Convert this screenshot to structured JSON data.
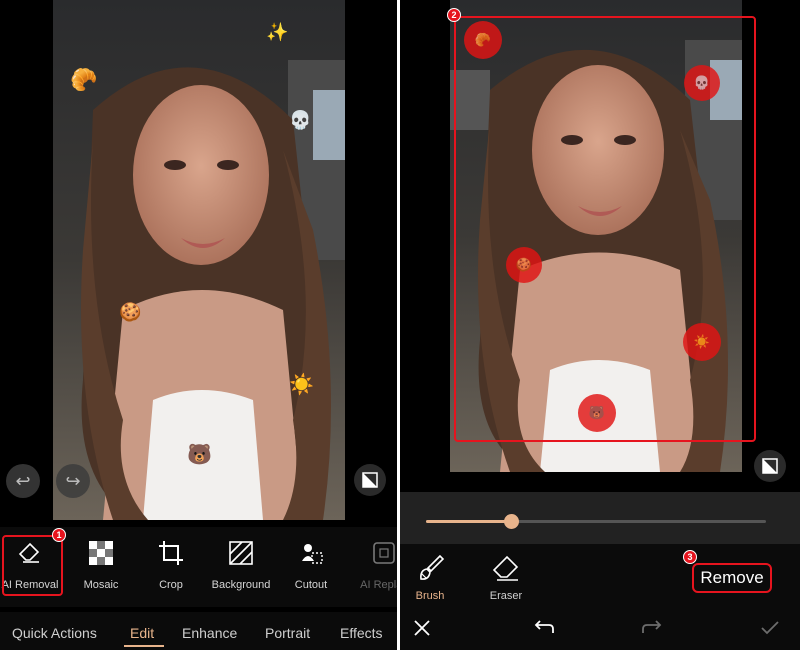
{
  "left": {
    "emojis": [
      {
        "name": "croissant-emoji",
        "glyph": "🥐"
      },
      {
        "name": "sparkles-emoji",
        "glyph": "✨"
      },
      {
        "name": "skull-emoji",
        "glyph": "💀"
      },
      {
        "name": "cookie-emoji",
        "glyph": "🍪"
      },
      {
        "name": "sun-emoji",
        "glyph": "☀️"
      },
      {
        "name": "bear-emoji",
        "glyph": "🐻"
      }
    ],
    "undo_glyph": "↩",
    "redo_glyph": "↪",
    "tools": [
      {
        "label": "AI Removal",
        "icon": "eraser-icon"
      },
      {
        "label": "Mosaic",
        "icon": "mosaic-icon"
      },
      {
        "label": "Crop",
        "icon": "crop-icon"
      },
      {
        "label": "Background",
        "icon": "background-icon"
      },
      {
        "label": "Cutout",
        "icon": "cutout-icon"
      },
      {
        "label": "AI Replac",
        "icon": "ai-replace-icon"
      }
    ],
    "tabs": [
      {
        "label": "Quick Actions",
        "active": false
      },
      {
        "label": "Edit",
        "active": true
      },
      {
        "label": "Enhance",
        "active": false
      },
      {
        "label": "Portrait",
        "active": false
      },
      {
        "label": "Effects",
        "active": false
      }
    ]
  },
  "right": {
    "brush_size_fraction": 0.25,
    "tools": [
      {
        "label": "Brush",
        "icon": "brush-icon",
        "active": true
      },
      {
        "label": "Eraser",
        "icon": "eraser-icon",
        "active": false
      }
    ],
    "remove_label": "Remove",
    "bottom_icons": [
      "close-icon",
      "undo-icon",
      "redo-icon",
      "check-icon"
    ]
  },
  "annotations": {
    "step1": "1",
    "step2": "2",
    "step3": "3",
    "color": "#e6141e"
  },
  "colors": {
    "accent": "#e8b48c",
    "highlight": "#e6141e"
  }
}
